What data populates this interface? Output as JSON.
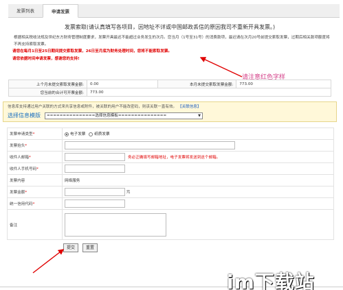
{
  "tabs": [
    {
      "label": "发票列表"
    },
    {
      "label": "申请发票"
    }
  ],
  "notice": {
    "title": "发票索取(请认真填写各项目，因地址不详或中国邮政丢信的原因我司不重新开具发票。)",
    "paragraph": "根据相关税收法规及世纪东方财务管理制度要求，发票开具最迟不能超过业务发生的次月。您当月（1号至31号）的消费款项，最迟请在次月20号前提交索取发票，过期后相关款项额度将不再支持索取发票。",
    "red_line1": "请您在每月1日至25日期间提交索取发票，26日至月底为财务处理时间，您将不能索取发票。",
    "red_line2": "请您依据时间申请发票，感谢您的支持!"
  },
  "amounts": {
    "last_month_label": "上个月未提交索取发票金额:",
    "last_month_value": "0.00",
    "this_month_label": "本月未提交索取发票金额:",
    "this_month_value": "773.00",
    "total_label": "您当前的合计可开票金额:",
    "total_value": "773.00"
  },
  "info": {
    "text": "信息库支持通过用户关联的方式来共享信息或附件，被关联的用户不能改密码，则该关联一直有效。",
    "link": "【关联信息】",
    "template_label": "选择信息模版",
    "template_select": "===============选择信息模板==============="
  },
  "form": {
    "type_label": "发票申请类型",
    "type_opt1": "电子发票",
    "type_opt2": "纸质发票",
    "title_label": "发票抬头",
    "email_label": "收件人邮箱",
    "email_hint": "务必正确填写邮箱地址，电子发票将发送到这个邮箱。",
    "phone_label": "收件人手机号码",
    "content_label": "发票内容",
    "content_value": "网络服务",
    "amount_label": "发票金额",
    "amount_unit": "元",
    "credit_label": "统一信用代码",
    "remark_label": "备注",
    "req_mark": "*"
  },
  "buttons": {
    "submit": "提交",
    "reset": "重置"
  },
  "annotation": "请注意红色字样",
  "watermark": "im下载站",
  "colors": {
    "red": "#e00000",
    "annotation": "#d4428a",
    "link": "#1a70c0"
  }
}
